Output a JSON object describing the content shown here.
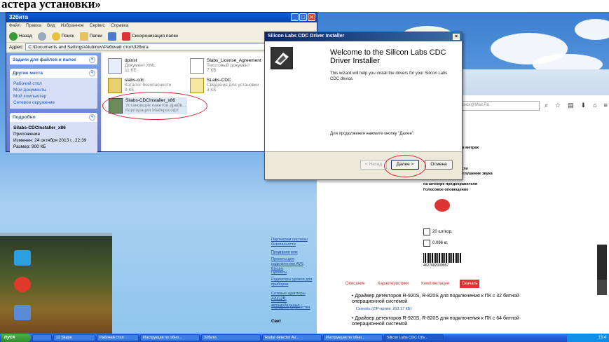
{
  "caption": "астера установки»",
  "explorer": {
    "title": "32бита",
    "menu": [
      "Файл",
      "Правка",
      "Вид",
      "Избранное",
      "Сервис",
      "Справка"
    ],
    "toolbar": {
      "back": "Назад",
      "search": "Поиск",
      "folders": "Папки",
      "sync": "Синхронизация папки"
    },
    "address_label": "Адрес:",
    "address": "C:\\Documents and Settings\\Alubinov\\Рабочий стол\\32бита",
    "tasks_panel": "Задачи для файлов и папок",
    "places_panel": "Другие места",
    "places": [
      "Рабочий стол",
      "Мои документы",
      "Мой компьютер",
      "Сетевое окружение"
    ],
    "details_panel": "Подробно",
    "details": {
      "name": "Silabs-CDCInstaller_x86",
      "type": "Приложение",
      "modified": "Изменен: 24 октября 2013 г., 22:39",
      "size": "Размер: 900 КБ"
    },
    "files": [
      {
        "name": "dpinst",
        "line2": "Документ XML",
        "line3": "11 КБ"
      },
      {
        "name": "Slabs_License_Agreement",
        "line2": "Текстовый документ",
        "line3": "7 КБ"
      },
      {
        "name": "slabs-cdc",
        "line2": "Каталог безопасности",
        "line3": "9 КБ"
      },
      {
        "name": "SLabs-CDC",
        "line2": "Сведения для установки",
        "line3": "3 КБ"
      },
      {
        "name": "Silabs-CDCInstaller_x86",
        "line2": "Установщик пакетов драйв...",
        "line3": "Корпорация Майкрософт"
      }
    ]
  },
  "installer": {
    "title": "Silicon Labs CDC Driver Installer",
    "heading": "Welcome to the Silicon Labs CDC Driver Installer",
    "body": "This wizard will help you install the drivers for your Silicon Labs CDC device.",
    "continue_text": "Для продолжения нажмите кнопку \"Далее\".",
    "back_button": "< Назад",
    "next_button": "Далее >",
    "cancel_button": "Отмена"
  },
  "browser": {
    "search_placeholder": "Поиск@Mail.Ru",
    "features": [
      "радарах «СТРЕЛКА»",
      "до 1000 метров",
      "сигналах лазера",
      "радарах и камер",
      "сигналах скорости",
      "радара или камеры в метрах",
      "скорость сигнала",
      "радара",
      "радара",
      "отключения дальности",
      "Автоматическое приглушение звука",
      "Кнопки вкл./выкл.",
      "на штекере предохранителя",
      "Голосовое оповещение"
    ],
    "pack": "20 шт/кор.",
    "weight": "0.096 кг.",
    "barcode": "4627082000957",
    "left_links": [
      "Партнерам системы безопасности",
      "Предприятиям",
      "Проекты для подключения AVS Electro",
      "Проекты",
      "Радиаторы уровня для приборов",
      "Сетевые адаптеры 220/12В",
      "Сетевые автомобильные",
      "Зарядные устройства"
    ],
    "tabs": [
      "Описание",
      "Характеристики",
      "Комплектация",
      "Скачать"
    ],
    "driver1": "Драйвер детекторов R-920S, R-820S для подключения к ПК с 32 битной операционной системой",
    "driver1_link": "Скачать (ZIP-архив: 263.17 КБ)",
    "driver2": "Драйвер детекторов R-920S, R-820S для подключения к ПК с 64 битной операционной системой",
    "side_label": "Бесплатный звонок",
    "more": "Свет"
  },
  "taskbar": {
    "start": "пуск",
    "tasks": [
      "11 Skype",
      "Рабочий стол",
      "Инструкция по обно...",
      "32бита",
      "Radar detector AV...",
      "Инструкция по обно...",
      "Silicon Labs CDC Driv..."
    ],
    "clock": "13:4"
  },
  "colors": {
    "xp_blue": "#0842b0",
    "accent_red": "#d33333",
    "link_blue": "#1a4c9c"
  }
}
